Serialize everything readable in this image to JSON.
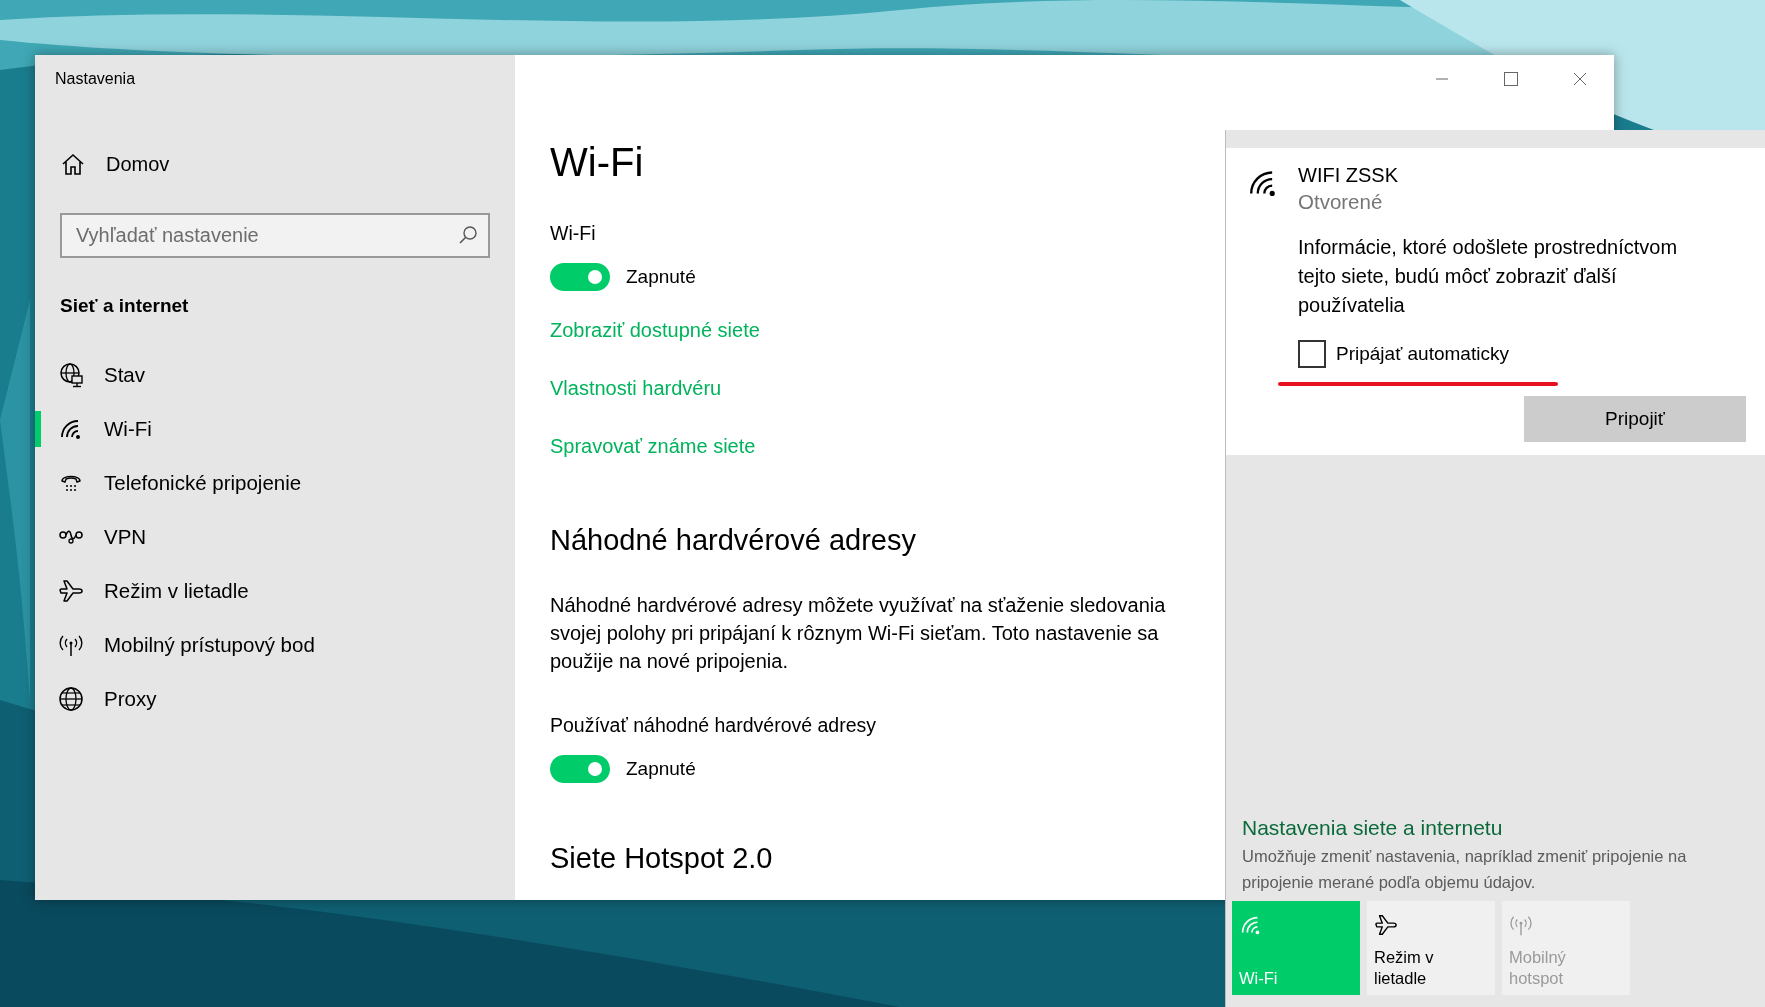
{
  "window": {
    "title": "Nastavenia"
  },
  "sidebar": {
    "home": "Domov",
    "search": {
      "placeholder": "Vyhľadať nastavenie"
    },
    "section": "Sieť a internet",
    "items": [
      {
        "label": "Stav",
        "kind": "status",
        "selected": false
      },
      {
        "label": "Wi-Fi",
        "kind": "wifi",
        "selected": true
      },
      {
        "label": "Telefonické pripojenie",
        "kind": "dialup",
        "selected": false
      },
      {
        "label": "VPN",
        "kind": "vpn",
        "selected": false
      },
      {
        "label": "Režim v lietadle",
        "kind": "airplane",
        "selected": false
      },
      {
        "label": "Mobilný prístupový bod",
        "kind": "hotspot",
        "selected": false
      },
      {
        "label": "Proxy",
        "kind": "proxy",
        "selected": false
      }
    ]
  },
  "main": {
    "title": "Wi-Fi",
    "wifi": {
      "label": "Wi-Fi",
      "state_text": "Zapnuté",
      "on": true
    },
    "links": [
      "Zobraziť dostupné siete",
      "Vlastnosti hardvéru",
      "Spravovať známe siete"
    ],
    "random_addresses": {
      "heading": "Náhodné hardvérové adresy",
      "text": "Náhodné hardvérové adresy môžete využívať na sťaženie sledovania svojej polohy pri pripájaní k rôznym Wi-Fi sieťam. Toto nastavenie sa použije na nové pripojenia.",
      "label": "Používať náhodné hardvérové adresy",
      "state_text": "Zapnuté",
      "on": true
    },
    "hotspot_heading": "Siete Hotspot 2.0"
  },
  "flyout": {
    "network": {
      "name": "WIFI ZSSK",
      "status": "Otvorené",
      "info": "Informácie, ktoré odošlete prostredníctvom tejto siete, budú môcť zobraziť ďalší používatelia",
      "auto_connect": {
        "label": "Pripájať automaticky",
        "checked": false
      },
      "connect_button": "Pripojiť"
    },
    "settings_link": {
      "title": "Nastavenia siete a internetu",
      "description": "Umožňuje zmeniť nastavenia, napríklad zmeniť pripojenie na pripojenie merané podľa objemu údajov."
    },
    "quick_actions": [
      {
        "label": "Wi-Fi",
        "kind": "wifi",
        "on": true,
        "disabled": false
      },
      {
        "label": "Režim v lietadle",
        "kind": "airplane",
        "on": false,
        "disabled": false
      },
      {
        "label": "Mobilný hotspot",
        "kind": "hotspot",
        "on": false,
        "disabled": true
      }
    ]
  }
}
